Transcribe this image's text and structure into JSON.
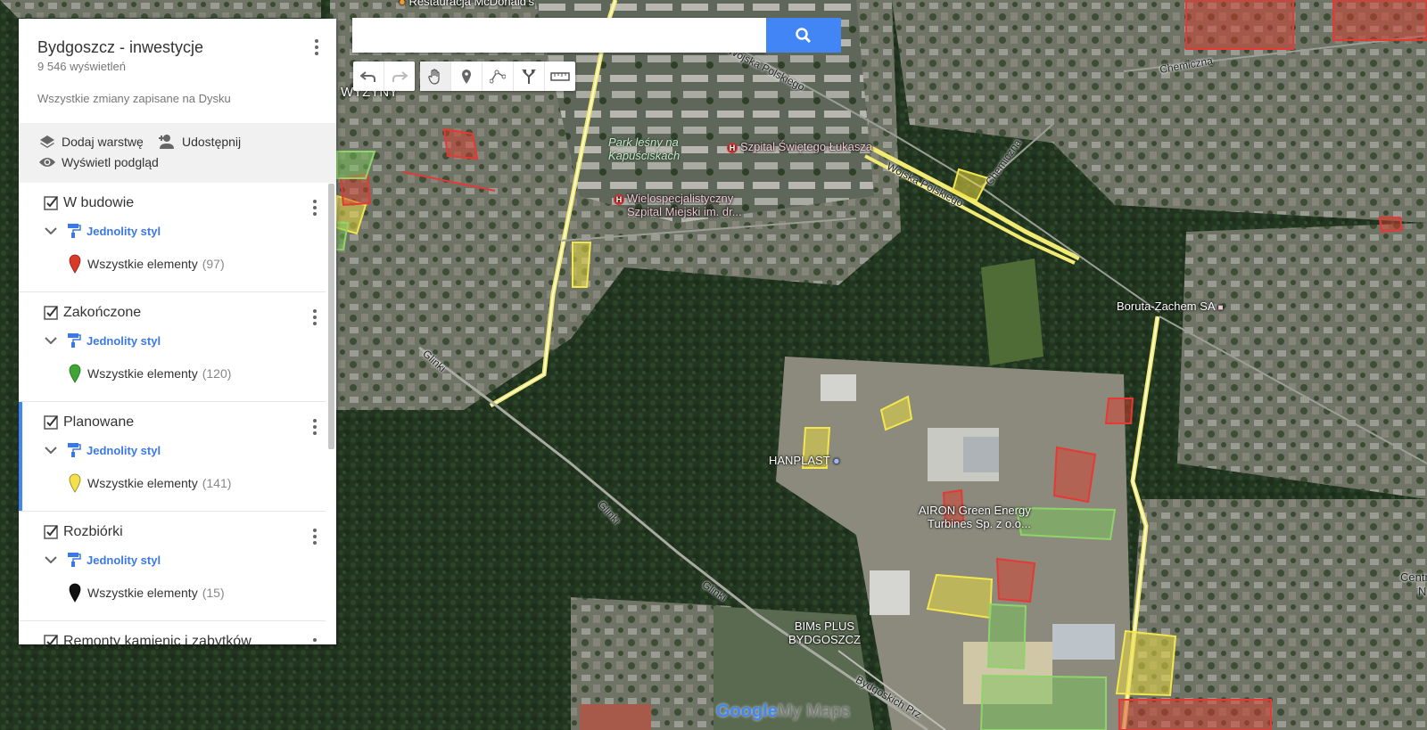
{
  "panel": {
    "title": "Bydgoszcz - inwestycje",
    "views": "9 546 wyświetleń",
    "save_status": "Wszystkie zmiany zapisane na Dysku",
    "actions": {
      "add_layer": "Dodaj warstwę",
      "share": "Udostępnij",
      "preview": "Wyświetl podgląd"
    },
    "layers": [
      {
        "name": "W budowie",
        "style": "Jednolity styl",
        "elements_label": "Wszystkie elementy",
        "count": "(97)",
        "color": "#d93b2b"
      },
      {
        "name": "Zakończone",
        "style": "Jednolity styl",
        "elements_label": "Wszystkie elementy",
        "count": "(120)",
        "color": "#3fa535"
      },
      {
        "name": "Planowane",
        "style": "Jednolity styl",
        "elements_label": "Wszystkie elementy",
        "count": "(141)",
        "color": "#f4e04d"
      },
      {
        "name": "Rozbiórki",
        "style": "Jednolity styl",
        "elements_label": "Wszystkie elementy",
        "count": "(15)",
        "color": "#111111"
      },
      {
        "name": "Remonty kamienic i zabytków"
      }
    ]
  },
  "search": {
    "value": "",
    "placeholder": ""
  },
  "map_labels": {
    "mcdonalds": "Restauracja McDonald's",
    "wyzyny": "WYŻYNY",
    "wojska_polskiego_1": "Wojska Polskiego",
    "wojska_polskiego_2": "Wojska Polskiego",
    "chemiczna_1": "Chemiczna",
    "chemiczna_2": "Chemiczna",
    "park": "Park leśny na Kapuściskach",
    "szpital_lukasza": "Szpital Świętego Łukasza",
    "szpital_miejski_1": "Wielospecjalistyczny",
    "szpital_miejski_2": "Szpital Miejski im. dr...",
    "boruta": "Boruta-Zachem SA",
    "glinki_1": "Glinki",
    "glinki_2": "Glinki",
    "glinki_3": "Glinki",
    "hanplast": "HANPLAST",
    "airon_1": "AIRON Green Energy",
    "airon_2": "Turbines Sp. z o.o...",
    "bims_1": "BIMs PLUS",
    "bims_2": "BYDGOSZCZ",
    "bydgoskich": "Bydgoskich Prz",
    "centr": "Centr",
    "centr_n": "N",
    "logo_google": "Google",
    "logo_mymaps": "My Maps"
  },
  "colors": {
    "accent": "#4285f4",
    "planned_fill": "#e7d842",
    "in_progress_fill": "#d93b2b",
    "completed_fill": "#7ac35a"
  }
}
